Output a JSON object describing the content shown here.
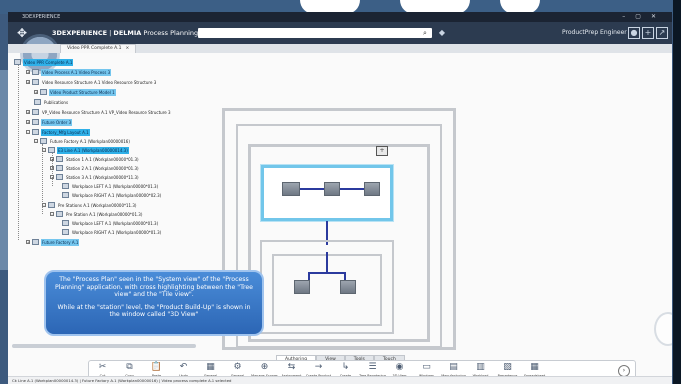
{
  "window": {
    "title": "3DEXPERIENCE"
  },
  "app": {
    "brand": "3DEXPERIENCE",
    "separator": " | ",
    "product": "DELMIA",
    "module": " Process Planning",
    "user": "ProductPrep Engineer"
  },
  "search": {
    "placeholder": ""
  },
  "document_tab": {
    "label": "Video PPR Complete A.1",
    "close": "×"
  },
  "tree": {
    "nodes": [
      {
        "label": "Video PPR Complete A.1"
      },
      {
        "label": "Video Process A.1 Video Process 3"
      },
      {
        "label": "Video Resource Structure A.1 Video Resource Structure 3"
      },
      {
        "label": "Video Product Structure Model 1"
      },
      {
        "label": "Publications"
      },
      {
        "label": "VP_Video Resource Structure A.1 VP_Video Resource Structure 3"
      },
      {
        "label": "Future Order 3"
      },
      {
        "label": "Factory_Mfg Layout A.1"
      },
      {
        "label": "Future Factory A.1 (Workplan00000016)"
      },
      {
        "label": "E3 Line A.1 (Workplan00000014.3)"
      },
      {
        "label": "Station 1 A.1 (Workplan00000*01.3)"
      },
      {
        "label": "Station 2 A.1 (Workplan00000*01.3)"
      },
      {
        "label": "Station 3 A.1 (Workplan00000*11.3)"
      },
      {
        "label": "Workplace LEFT A.1 (Workplan00000*01.3)"
      },
      {
        "label": "Workplace RIGHT A.1 (Workplan00000*02.3)"
      },
      {
        "label": "Pre Stations A.1 (Workplan00000*11.3)"
      },
      {
        "label": "Pre Station A.1 (Workplan00000*01.3)"
      },
      {
        "label": "Workplace LEFT A.1 (Workplan00000*01.3)"
      },
      {
        "label": "Workplace RIGHT A.1 (Workplan00000*01.3)"
      },
      {
        "label": "Future Factory A.1"
      }
    ]
  },
  "caption": {
    "line1": "The \"Process Plan\" seen in the \"System view\" of the \"Process Planning\" application, with cross highlighting between the \"Tree view\" and the \"Tile view\".",
    "line2": "While at the \"station\" level, the \"Product Build-Up\" is shown in the window called \"3D View\""
  },
  "view_tabs": [
    "Authoring",
    "View",
    "Tools",
    "Touch"
  ],
  "actions": [
    {
      "icon": "scissors-icon",
      "glyph": "✂",
      "label": "Cut"
    },
    {
      "icon": "copy-icon",
      "glyph": "⧉",
      "label": "Copy"
    },
    {
      "icon": "paste-icon",
      "glyph": "📋",
      "label": "Paste"
    },
    {
      "icon": "undo-icon",
      "glyph": "↶",
      "label": "Undo"
    },
    {
      "icon": "general-system-icon",
      "glyph": "▦",
      "label": "General System"
    },
    {
      "icon": "general-operation-icon",
      "glyph": "⚙",
      "label": "General Operation"
    },
    {
      "icon": "manage-scopes-icon",
      "glyph": "⊕",
      "label": "Manage Scopes"
    },
    {
      "icon": "assignment-manager-icon",
      "glyph": "⇆",
      "label": "Assignment Manager"
    },
    {
      "icon": "create-flow-icon",
      "glyph": "→",
      "label": "Create Product Flow"
    },
    {
      "icon": "create-precedence-icon",
      "glyph": "↳",
      "label": "Create Precedence"
    },
    {
      "icon": "tree-reordering-icon",
      "glyph": "☰",
      "label": "Tree Reordering"
    },
    {
      "icon": "3d-view-icon",
      "glyph": "◉",
      "label": "3D View"
    },
    {
      "icon": "windows-icon",
      "glyph": "▭",
      "label": "Windows"
    },
    {
      "icon": "manufacturing-system-icon",
      "glyph": "▤",
      "label": "Manufacturing System Level"
    },
    {
      "icon": "workload-balancer-icon",
      "glyph": "▥",
      "label": "Workload Balancer"
    },
    {
      "icon": "precedence-graph-icon",
      "glyph": "▧",
      "label": "Precedence Graph"
    },
    {
      "icon": "spreadsheet-icon",
      "glyph": "▦",
      "label": "Spreadsheet"
    }
  ],
  "status": {
    "text": "Ck Line A.1 (Workplan00000014.3) | Future Factory A.1 (Workplan00000016) | Video process complete A.1 selected"
  }
}
